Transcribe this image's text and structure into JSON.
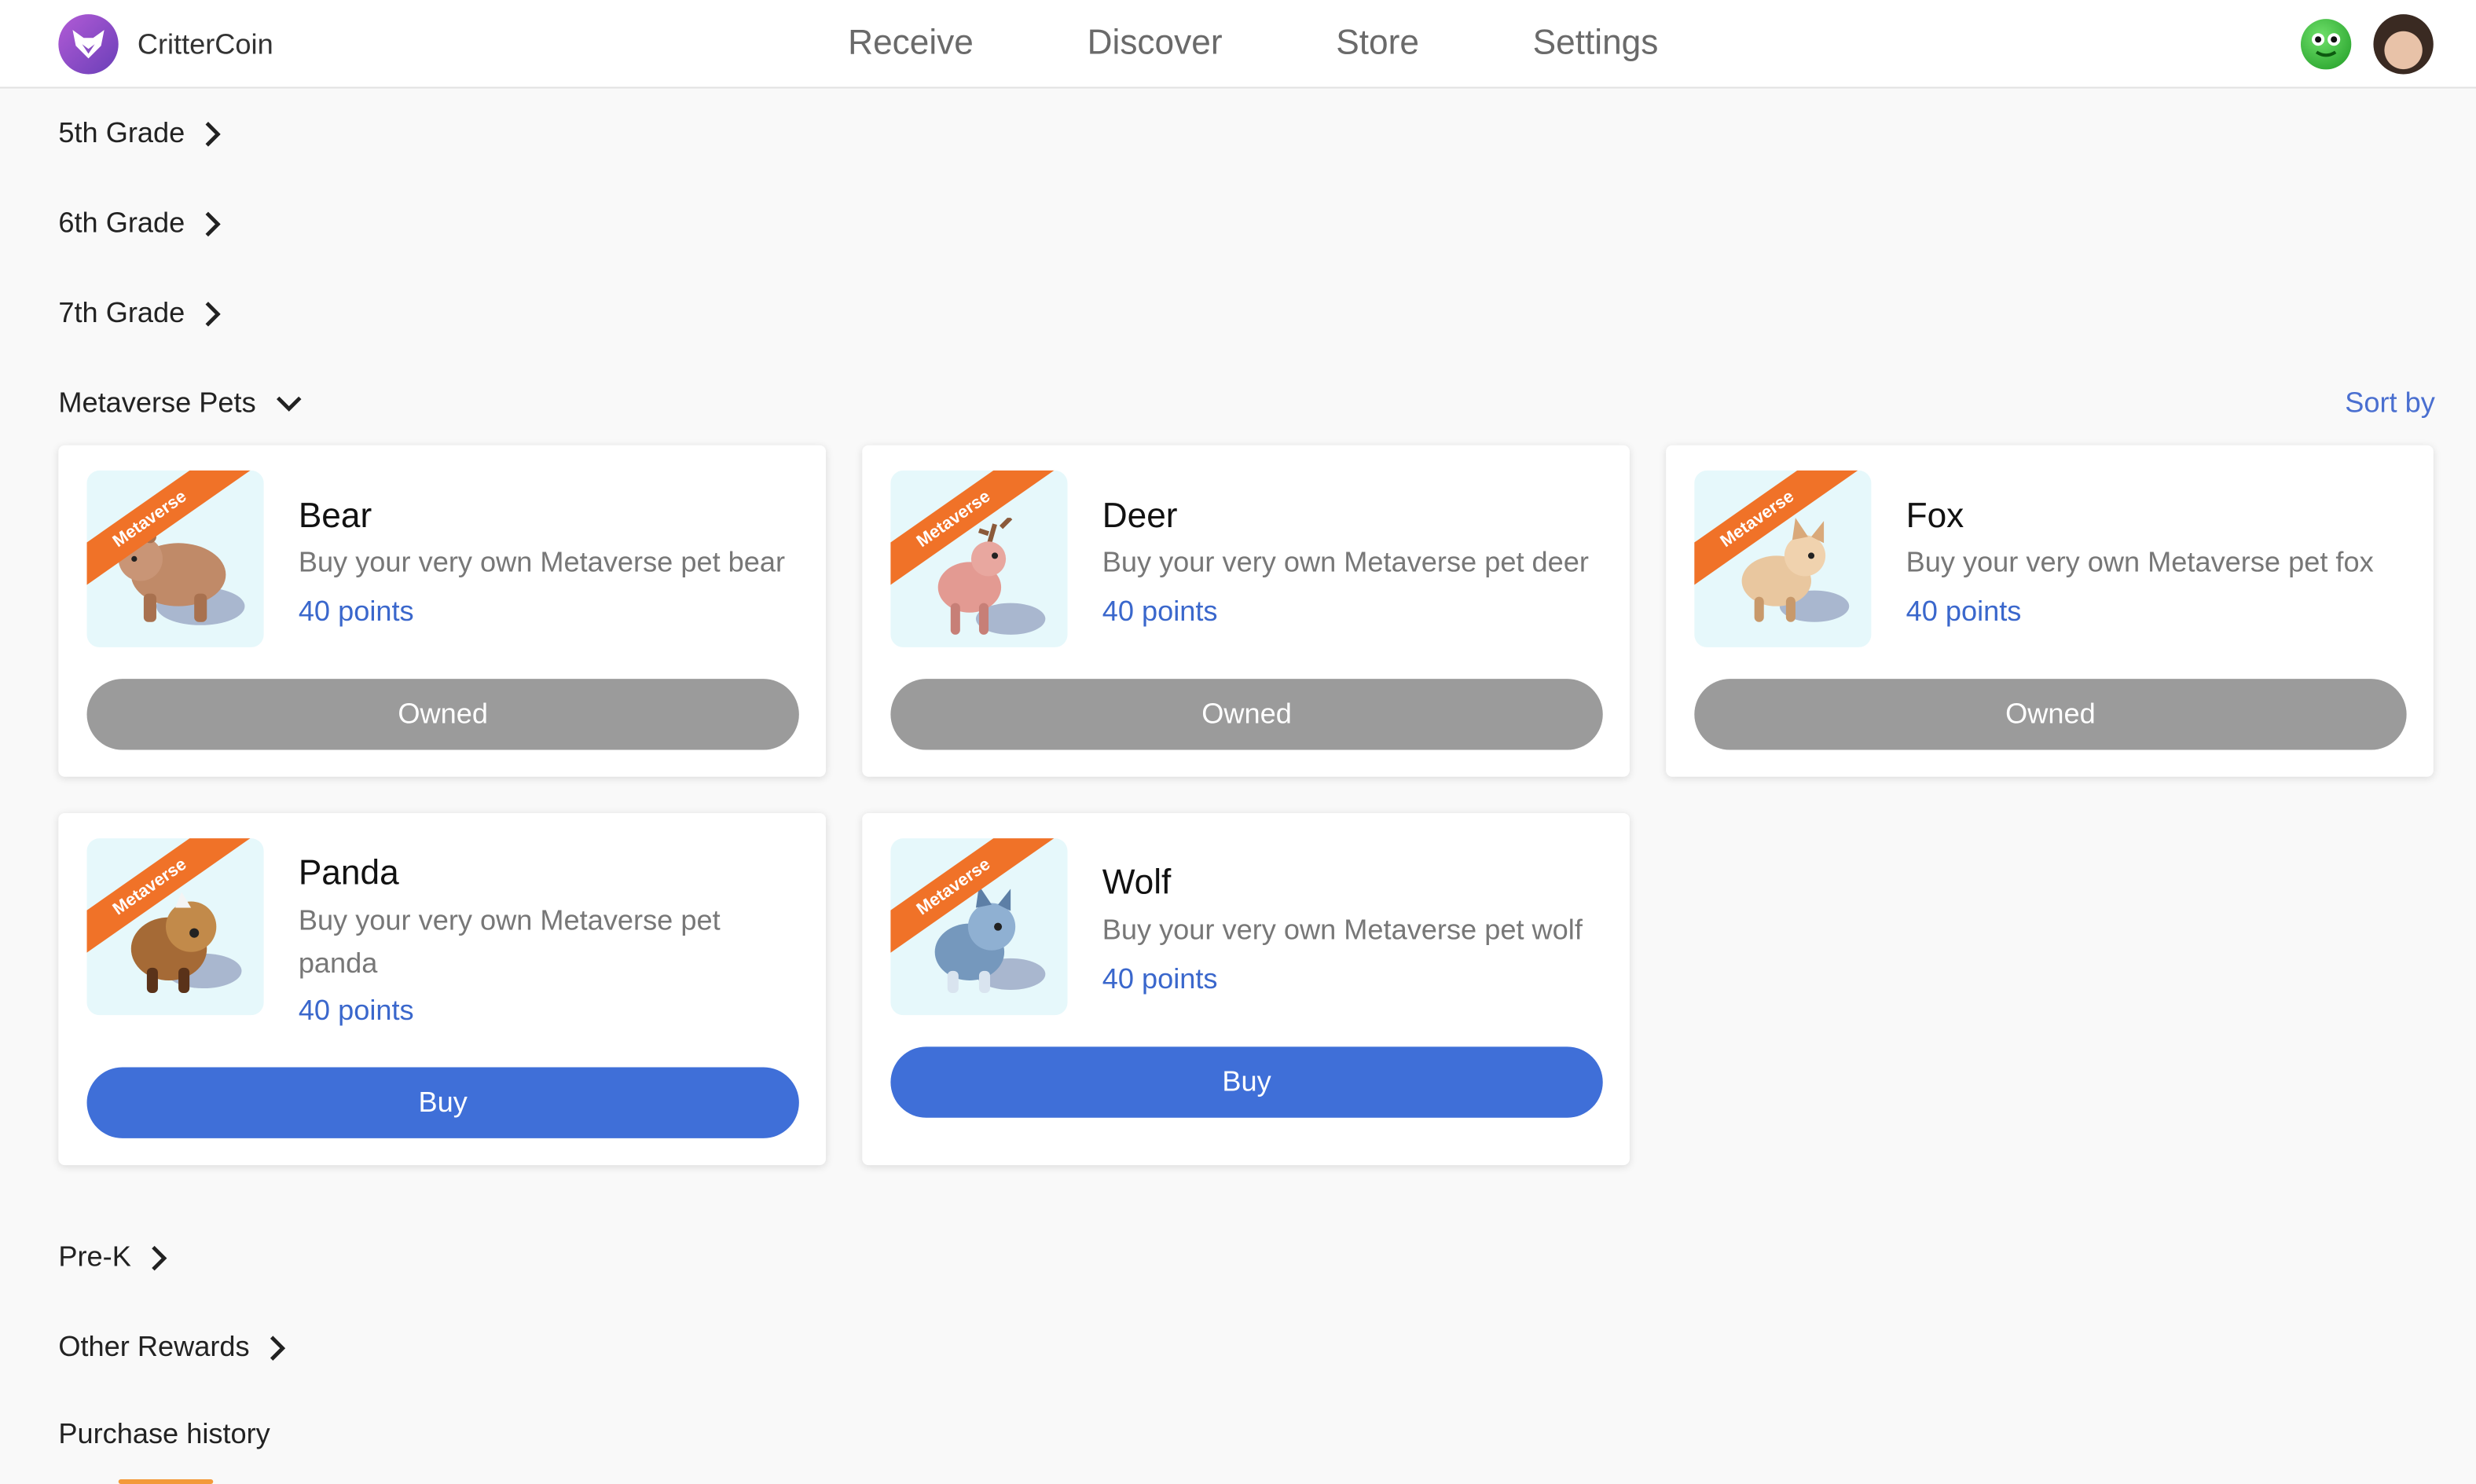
{
  "app": {
    "name": "CritterCoin"
  },
  "nav": [
    {
      "label": "Receive"
    },
    {
      "label": "Discover"
    },
    {
      "label": "Store"
    },
    {
      "label": "Settings"
    }
  ],
  "categories": {
    "grade5": "5th Grade",
    "grade6": "6th Grade",
    "grade7": "7th Grade",
    "metaverse": "Metaverse Pets",
    "prek": "Pre-K",
    "other": "Other Rewards",
    "history": "Purchase history"
  },
  "sort_label": "Sort by",
  "ribbon_label": "Metaverse",
  "colors": {
    "accent_blue": "#3f6fd8",
    "owned_gray": "#9b9b9b",
    "ribbon_orange": "#f07228"
  },
  "items": [
    {
      "name": "Bear",
      "desc": "Buy your very own Metaverse pet bear",
      "points": "40 points",
      "action": "Owned",
      "pet_color": "#c08a68"
    },
    {
      "name": "Deer",
      "desc": "Buy your very own Metaverse pet deer",
      "points": "40 points",
      "action": "Owned",
      "pet_color": "#e39a92"
    },
    {
      "name": "Fox",
      "desc": "Buy your very own Metaverse pet fox",
      "points": "40 points",
      "action": "Owned",
      "pet_color": "#e9c79f"
    },
    {
      "name": "Panda",
      "desc": "Buy your very own Metaverse pet panda",
      "points": "40 points",
      "action": "Buy",
      "pet_color": "#a56a36"
    },
    {
      "name": "Wolf",
      "desc": "Buy your very own Metaverse pet wolf",
      "points": "40 points",
      "action": "Buy",
      "pet_color": "#7598bd"
    }
  ]
}
